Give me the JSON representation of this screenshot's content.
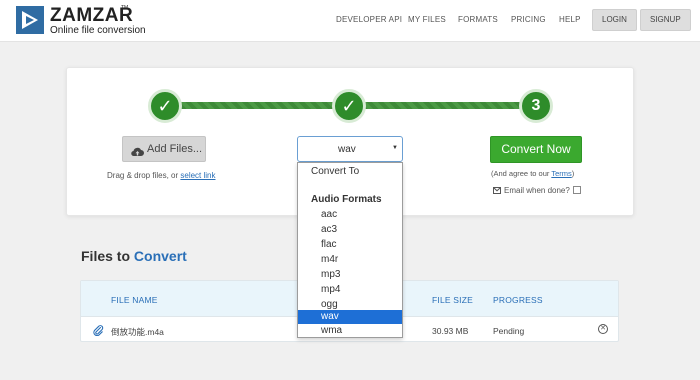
{
  "header": {
    "brand": "ZAMZAR",
    "brand_tm": "TM",
    "tagline": "Online file conversion",
    "nav": [
      "DEVELOPER API",
      "MY FILES",
      "FORMATS",
      "PRICING",
      "HELP"
    ],
    "login_label": "LOGIN",
    "signup_label": "SIGNUP"
  },
  "steps": [
    {
      "label": "✓",
      "state": "done"
    },
    {
      "label": "✓",
      "state": "done"
    },
    {
      "label": "3",
      "state": "current"
    }
  ],
  "upload": {
    "add_files_label": "Add Files...",
    "drag_text": "Drag & drop files, or ",
    "select_link": "select link"
  },
  "format_select": {
    "value": "wav",
    "caret": "▼"
  },
  "dropdown": {
    "placeholder": "Convert To",
    "group_label": "Audio Formats",
    "options": [
      "aac",
      "ac3",
      "flac",
      "m4r",
      "mp3",
      "mp4",
      "ogg",
      "wav",
      "wma"
    ],
    "selected": "wav"
  },
  "convert": {
    "button_label": "Convert Now",
    "terms_prefix": "(And agree to our ",
    "terms_link": "Terms",
    "terms_suffix": ")",
    "email_label": "Email when done?"
  },
  "files": {
    "heading_prefix": "Files to ",
    "heading_accent": "Convert",
    "columns": [
      "FILE NAME",
      "FILE SIZE",
      "PROGRESS"
    ],
    "rows": [
      {
        "name": "倒放功能.m4a",
        "size": "30.93 MB",
        "progress": "Pending"
      }
    ]
  },
  "colors": {
    "brand_blue": "#2f6ca3",
    "step_green": "#2e8c2a",
    "convert_green": "#3ba92f",
    "link_blue": "#2a6fb7",
    "selected_blue": "#1e6fd6"
  }
}
